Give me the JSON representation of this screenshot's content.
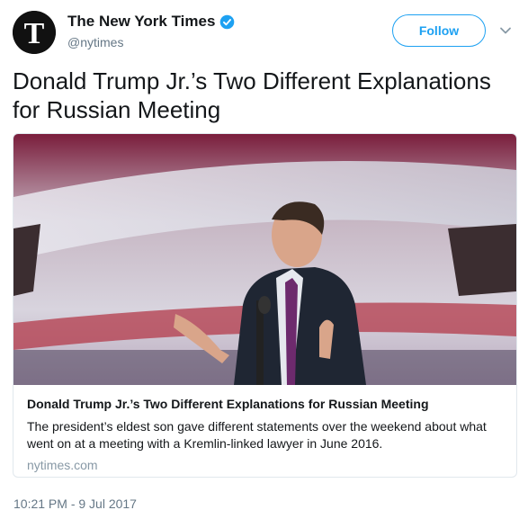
{
  "account": {
    "display_name": "The New York Times",
    "handle": "@nytimes",
    "verified": true,
    "avatar_icon": "nyt-logo-icon"
  },
  "actions": {
    "follow_label": "Follow",
    "more_icon": "chevron-down-icon"
  },
  "tweet": {
    "text": "Donald Trump Jr.’s Two Different Explanations for Russian Meeting",
    "timestamp": "10:21 PM - 9 Jul 2017"
  },
  "card": {
    "title": "Donald Trump Jr.’s Two Different Explanations for Russian Meeting",
    "description": "The president’s eldest son gave different statements over the weekend about what went on at a meeting with a Kremlin-linked lawyer in June 2016.",
    "domain": "nytimes.com"
  },
  "colors": {
    "accent": "#1da1f2",
    "secondary_text": "#657786",
    "border": "#e1e8ed"
  }
}
